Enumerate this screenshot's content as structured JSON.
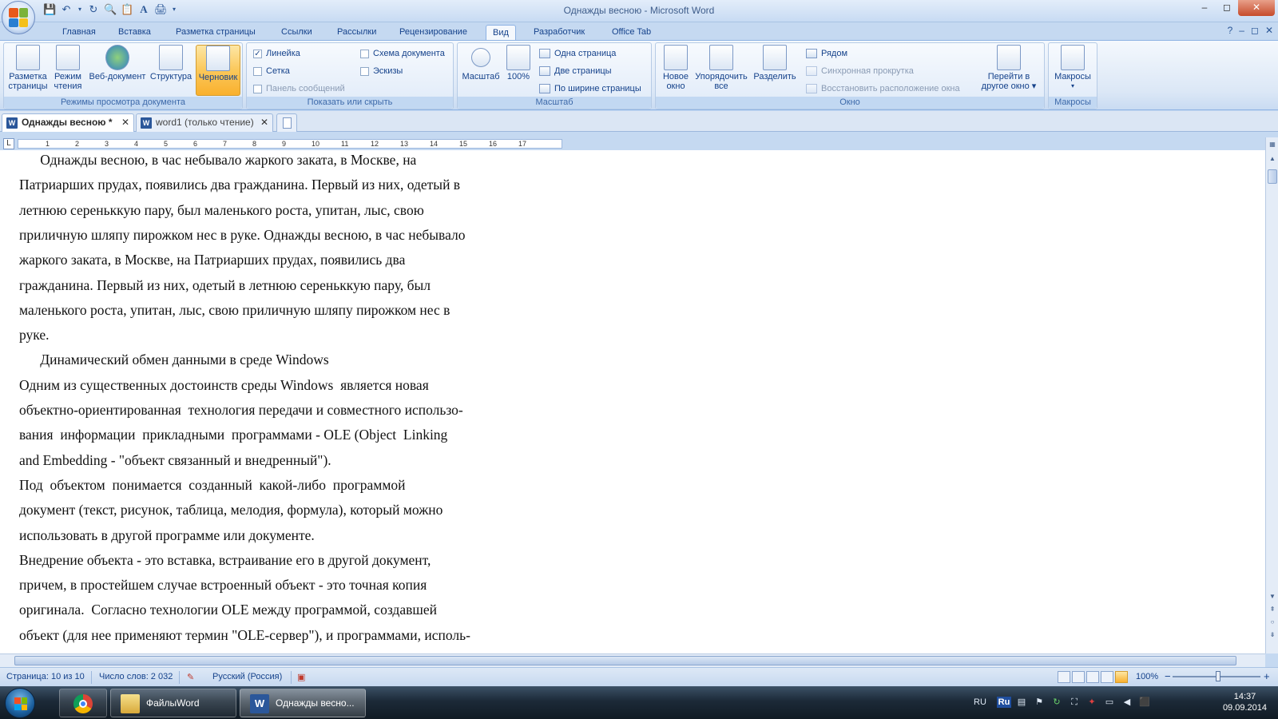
{
  "window": {
    "title": "Однажды весною - Microsoft Word",
    "minimize": "–",
    "maximize": "◻",
    "close": "✕"
  },
  "ribbon_tabs": [
    "Главная",
    "Вставка",
    "Разметка страницы",
    "Ссылки",
    "Рассылки",
    "Рецензирование",
    "Вид",
    "Разработчик",
    "Office Tab"
  ],
  "active_tab": "Вид",
  "groups": {
    "views": {
      "label": "Режимы просмотра документа",
      "buttons": [
        {
          "line1": "Разметка",
          "line2": "страницы"
        },
        {
          "line1": "Режим",
          "line2": "чтения"
        },
        {
          "line1": "Веб-документ",
          "line2": ""
        },
        {
          "line1": "Структура",
          "line2": ""
        },
        {
          "line1": "Черновик",
          "line2": ""
        }
      ]
    },
    "show": {
      "label": "Показать или скрыть",
      "items": [
        {
          "label": "Линейка",
          "checked": "✓"
        },
        {
          "label": "Сетка",
          "checked": ""
        },
        {
          "label": "Панель сообщений",
          "checked": ""
        },
        {
          "label": "Схема документа",
          "checked": ""
        },
        {
          "label": "Эскизы",
          "checked": ""
        }
      ]
    },
    "zoom": {
      "label": "Масштаб",
      "buttons": [
        {
          "line1": "Масштаб",
          "line2": ""
        },
        {
          "line1": "100%",
          "line2": ""
        }
      ],
      "small": [
        "Одна страница",
        "Две страницы",
        "По ширине страницы"
      ]
    },
    "window": {
      "label": "Окно",
      "buttons": [
        {
          "line1": "Новое",
          "line2": "окно"
        },
        {
          "line1": "Упорядочить",
          "line2": "все"
        },
        {
          "line1": "Разделить",
          "line2": ""
        }
      ],
      "small": [
        "Рядом",
        "Синхронная прокрутка",
        "Восстановить расположение окна"
      ],
      "switch": {
        "line1": "Перейти в",
        "line2": "другое окно ▾"
      }
    },
    "macros": {
      "label": "Макросы",
      "button": {
        "line1": "Макросы",
        "line2": "▾"
      }
    }
  },
  "doc_tabs": [
    {
      "label": "Однажды весною *",
      "close": "✕"
    },
    {
      "label": "word1 (только чтение)",
      "close": "✕"
    }
  ],
  "ruler": {
    "corner": "L",
    "numbers": [
      "1",
      "2",
      "3",
      "4",
      "5",
      "6",
      "7",
      "8",
      "9",
      "10",
      "11",
      "12",
      "13",
      "14",
      "15",
      "16",
      "17"
    ]
  },
  "document": {
    "lines": [
      "      Однажды весною, в час небывало жаркого заката, в Москве, на",
      "Патриарших прудах, появились два гражданина. Первый из них, одетый в",
      "летнюю сереньккую пару, был маленького роста, упитан, лыс, свою",
      "приличную шляпу пирожком нес в руке. Однажды весною, в час небывало",
      "жаркого заката, в Москве, на Патриарших прудах, появились два",
      "гражданина. Первый из них, одетый в летнюю сереньккую пару, был",
      "маленького роста, упитан, лыс, свою приличную шляпу пирожком нес в",
      "руке.",
      "      Динамический обмен данными в среде Windows",
      "Одним из существенных достоинств среды Windows  является новая",
      "объектно-ориентированная  технология передачи и совместного использо-",
      "вания  информации  прикладными  программами - OLE (Object  Linking",
      "and Embedding - \"объект связанный и внедренный\").",
      "Под  объектом  понимается  созданный  какой-либо  программой",
      "документ (текст, рисунок, таблица, мелодия, формула), который можно",
      "использовать в другой программе или документе.",
      "Внедрение объекта - это вставка, встраивание его в другой документ,",
      "причем, в простейшем случае встроенный объект - это точная копия",
      "оригинала.  Согласно технологии OLE между программой, создавшей",
      "объект (для нее применяют термин \"OLE-сервер\"), и программами, исполь-"
    ]
  },
  "status": {
    "page": "Страница: 10 из 10",
    "words": "Число слов: 2 032",
    "language": "Русский (Россия)",
    "zoom": "100%",
    "zoom_minus": "−",
    "zoom_plus": "+"
  },
  "taskbar": {
    "windows": [
      {
        "label": "ФайлыWord"
      },
      {
        "label": "Однажды весно..."
      }
    ],
    "lang": "RU",
    "lang2": "Ru",
    "time": "14:37",
    "date": "09.09.2014"
  },
  "colors": {
    "accent": "#2b579a",
    "ribbon_active": "#f9b02e",
    "squiggle": "#dd0000"
  }
}
